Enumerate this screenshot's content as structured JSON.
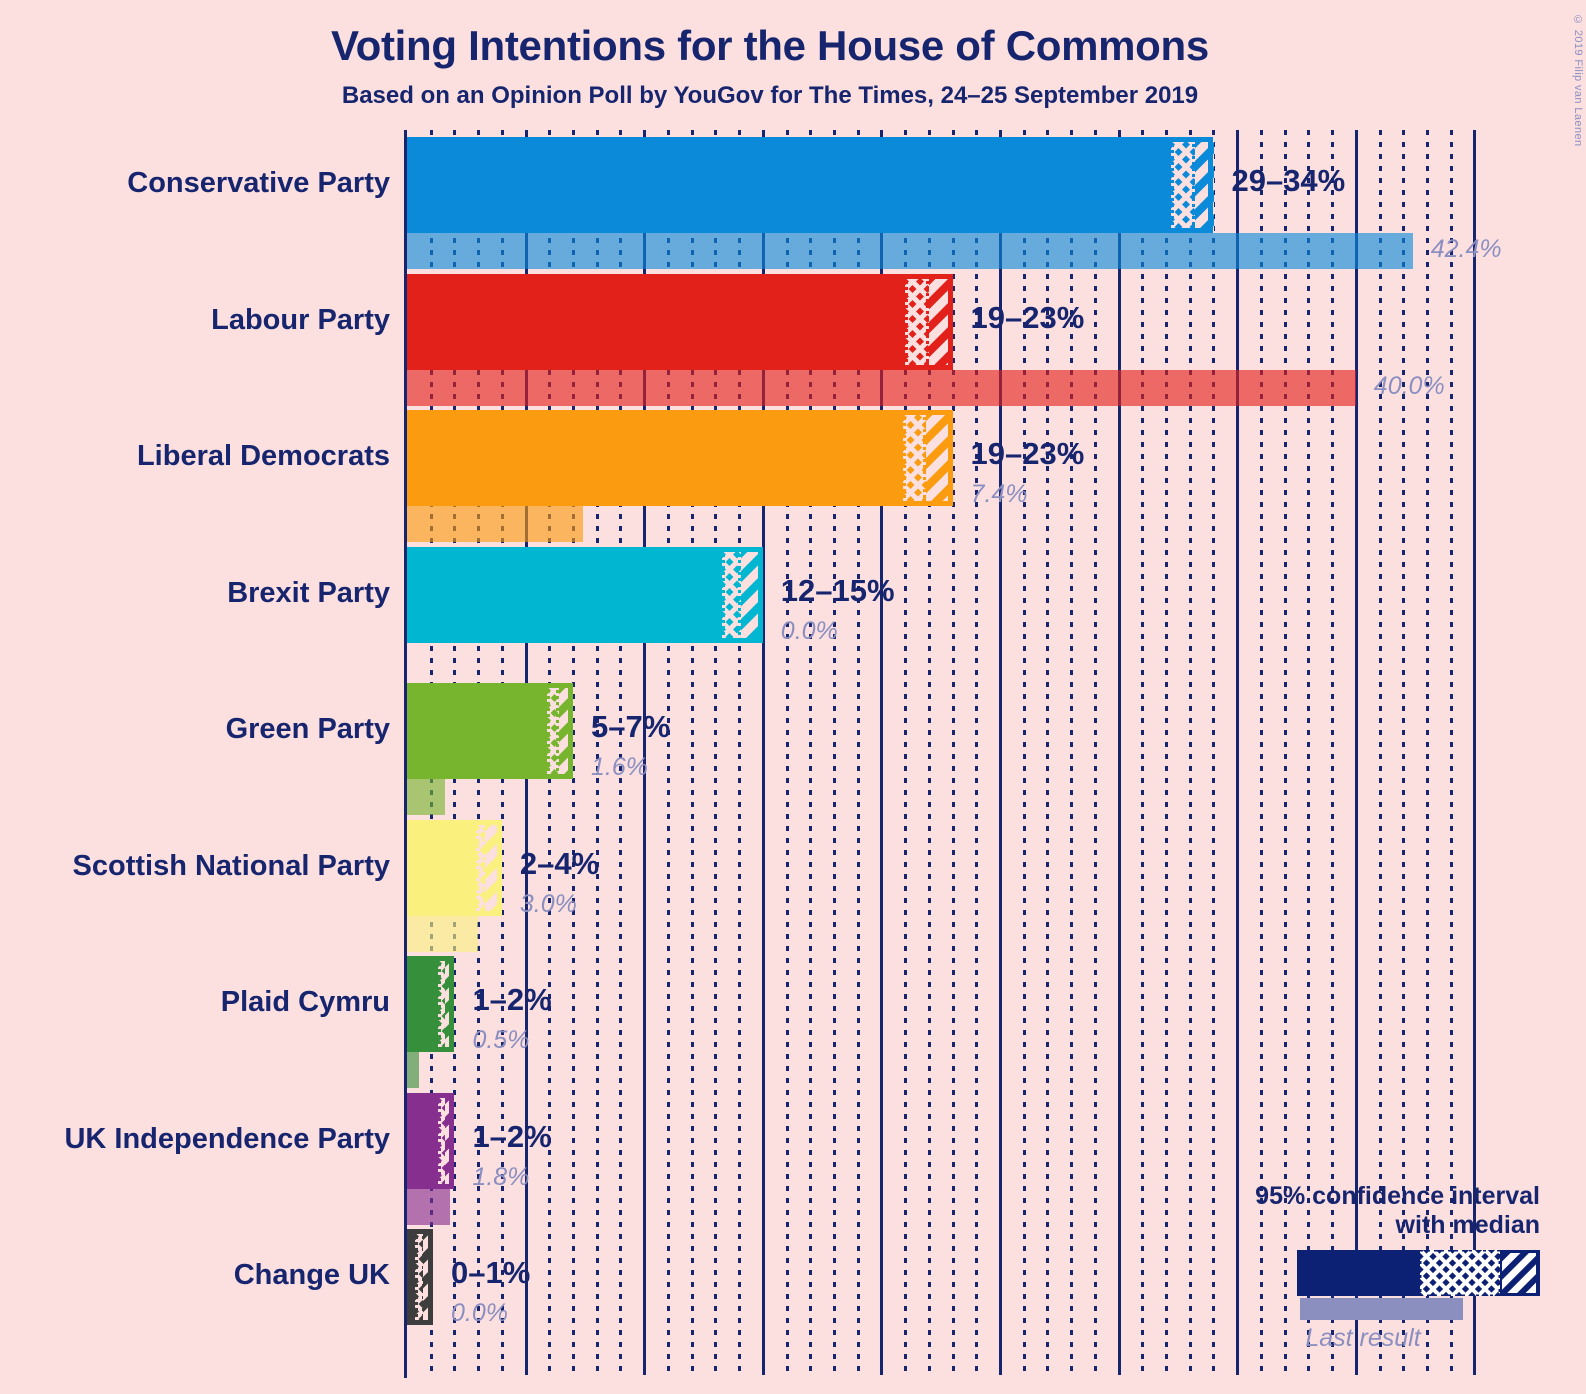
{
  "header": {
    "title": "Voting Intentions for the House of Commons",
    "subtitle": "Based on an Opinion Poll by YouGov for The Times, 24–25 September 2019",
    "copyright": "© 2019 Filip van Laenen"
  },
  "legend": {
    "caption_line1": "95% confidence interval",
    "caption_line2": "with median",
    "last_result_label": "Last result",
    "ci_color": "#0c2074",
    "last_color": "#8b8fc0"
  },
  "chart_data": {
    "type": "bar",
    "title": "Voting Intentions for the House of Commons",
    "subtitle": "Based on an Opinion Poll by YouGov for The Times, 24–25 September 2019",
    "xlabel": "",
    "ylabel": "",
    "xlim": [
      0,
      45
    ],
    "grid": true,
    "grid_major_step": 5,
    "grid_minor_step": 1,
    "legend_position": "bottom-right",
    "value_unit": "%",
    "categories": [
      "Conservative Party",
      "Labour Party",
      "Liberal Democrats",
      "Brexit Party",
      "Green Party",
      "Scottish National Party",
      "Plaid Cymru",
      "UK Independence Party",
      "Change UK"
    ],
    "series": [
      {
        "name": "95% confidence interval (low)",
        "values": [
          29,
          19,
          19,
          12,
          5,
          2,
          1,
          1,
          0
        ]
      },
      {
        "name": "95% confidence interval (high)",
        "values": [
          34,
          23,
          23,
          15,
          7,
          4,
          2,
          2,
          1
        ]
      },
      {
        "name": "Last result",
        "values": [
          42.4,
          40.0,
          7.4,
          0.0,
          1.6,
          3.0,
          0.5,
          1.8,
          0.0
        ]
      }
    ],
    "parties": [
      {
        "name": "Conservative Party",
        "ci_label": "29–34%",
        "ci_low": 29,
        "ci_high": 34,
        "median_low": 32.2,
        "median_high": 33.2,
        "last_result": 42.4,
        "last_result_label": "42.4%",
        "color": "#0a8ad8"
      },
      {
        "name": "Labour Party",
        "ci_label": "19–23%",
        "ci_low": 19,
        "ci_high": 23,
        "median_low": 21.0,
        "median_high": 22.0,
        "last_result": 40.0,
        "last_result_label": "40.0%",
        "color": "#e3211b"
      },
      {
        "name": "Liberal Democrats",
        "ci_label": "19–23%",
        "ci_low": 19,
        "ci_high": 23,
        "median_low": 20.9,
        "median_high": 21.9,
        "last_result": 7.4,
        "last_result_label": "7.4%",
        "color": "#fa9b10"
      },
      {
        "name": "Brexit Party",
        "ci_label": "12–15%",
        "ci_low": 12,
        "ci_high": 15,
        "median_low": 13.3,
        "median_high": 14.1,
        "last_result": 0.0,
        "last_result_label": "0.0%",
        "color": "#00b6d1"
      },
      {
        "name": "Green Party",
        "ci_label": "5–7%",
        "ci_low": 5,
        "ci_high": 7,
        "median_low": 5.9,
        "median_high": 6.4,
        "last_result": 1.6,
        "last_result_label": "1.6%",
        "color": "#78b52e"
      },
      {
        "name": "Scottish National Party",
        "ci_label": "2–4%",
        "ci_low": 2,
        "ci_high": 4,
        "median_low": 2.9,
        "median_high": 3.3,
        "last_result": 3.0,
        "last_result_label": "3.0%",
        "color": "#f9f07e"
      },
      {
        "name": "Plaid Cymru",
        "ci_label": "1–2%",
        "ci_low": 1,
        "ci_high": 2,
        "median_low": 1.3,
        "median_high": 1.6,
        "last_result": 0.5,
        "last_result_label": "0.5%",
        "color": "#368f3a"
      },
      {
        "name": "UK Independence Party",
        "ci_label": "1–2%",
        "ci_low": 1,
        "ci_high": 2,
        "median_low": 1.3,
        "median_high": 1.6,
        "last_result": 1.8,
        "last_result_label": "1.8%",
        "color": "#862f8f"
      },
      {
        "name": "Change UK",
        "ci_label": "0–1%",
        "ci_low": 0,
        "ci_high": 1,
        "median_low": 0.35,
        "median_high": 0.68,
        "last_result": 0.0,
        "last_result_label": "0.0%",
        "color": "#3d3d3d"
      }
    ]
  },
  "style": {
    "background": "#fce0e0",
    "text_color": "#16256e",
    "muted_color": "#8b8fc0"
  }
}
